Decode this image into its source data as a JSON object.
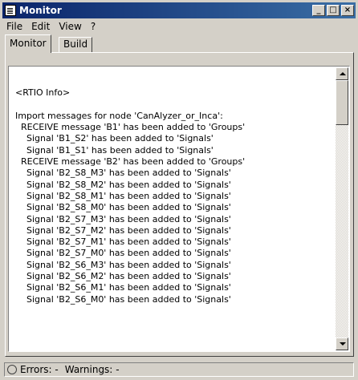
{
  "window": {
    "title": "Monitor"
  },
  "titlebar_buttons": {
    "minimize": "_",
    "maximize": "□",
    "close": "×"
  },
  "menu": [
    "File",
    "Edit",
    "View",
    "?"
  ],
  "tabs": [
    {
      "label": "Monitor",
      "active": true
    },
    {
      "label": "Build",
      "active": false
    }
  ],
  "log": [
    "",
    "<RTIO Info>",
    "",
    "Import messages for node 'CanAlyzer_or_Inca':",
    "  RECEIVE message 'B1' has been added to 'Groups'",
    "    Signal 'B1_S2' has been added to 'Signals'",
    "    Signal 'B1_S1' has been added to 'Signals'",
    "  RECEIVE message 'B2' has been added to 'Groups'",
    "    Signal 'B2_S8_M3' has been added to 'Signals'",
    "    Signal 'B2_S8_M2' has been added to 'Signals'",
    "    Signal 'B2_S8_M1' has been added to 'Signals'",
    "    Signal 'B2_S8_M0' has been added to 'Signals'",
    "    Signal 'B2_S7_M3' has been added to 'Signals'",
    "    Signal 'B2_S7_M2' has been added to 'Signals'",
    "    Signal 'B2_S7_M1' has been added to 'Signals'",
    "    Signal 'B2_S7_M0' has been added to 'Signals'",
    "    Signal 'B2_S6_M3' has been added to 'Signals'",
    "    Signal 'B2_S6_M2' has been added to 'Signals'",
    "    Signal 'B2_S6_M1' has been added to 'Signals'",
    "    Signal 'B2_S6_M0' has been added to 'Signals'"
  ],
  "status": {
    "errors_label": "Errors:",
    "errors_value": "-",
    "warnings_label": "Warnings:",
    "warnings_value": "-"
  }
}
